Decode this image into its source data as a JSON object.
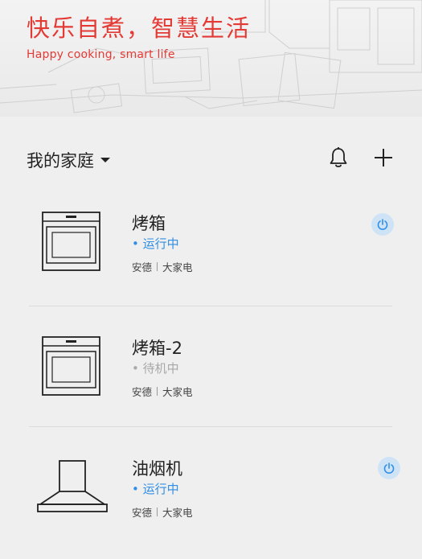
{
  "hero": {
    "title": "快乐自煮，智慧生活",
    "subtitle": "Happy cooking, smart life",
    "accent_color": "#e33a36"
  },
  "home": {
    "name": "我的家庭",
    "icons": {
      "notifications": "bell-icon",
      "add": "plus-icon",
      "selector": "caret-down-icon"
    }
  },
  "devices": [
    {
      "name": "烤箱",
      "status": "运行中",
      "running": true,
      "brand": "安德",
      "category": "大家电",
      "icon": "oven-icon"
    },
    {
      "name": "烤箱-2",
      "status": "待机中",
      "running": false,
      "brand": "安德",
      "category": "大家电",
      "icon": "oven-icon"
    },
    {
      "name": "油烟机",
      "status": "运行中",
      "running": true,
      "brand": "安德",
      "category": "大家电",
      "icon": "range-hood-icon"
    }
  ],
  "colors": {
    "running": "#2f8ee5",
    "standby": "#a8a8a8",
    "power_bg": "#cfe3f6"
  }
}
